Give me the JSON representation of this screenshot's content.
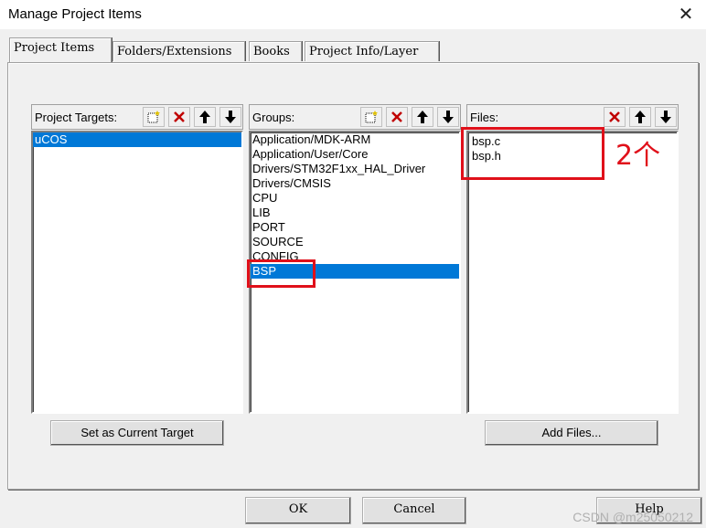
{
  "window": {
    "title": "Manage Project Items",
    "close_glyph": "✕"
  },
  "tabs": [
    {
      "label": "Project Items",
      "active": true
    },
    {
      "label": "Folders/Extensions",
      "active": false
    },
    {
      "label": "Books",
      "active": false
    },
    {
      "label": "Project Info/Layer",
      "active": false
    }
  ],
  "targets": {
    "label": "Project Targets:",
    "items": [
      "uCOS"
    ],
    "selected": "uCOS"
  },
  "groups": {
    "label": "Groups:",
    "items": [
      "Application/MDK-ARM",
      "Application/User/Core",
      "Drivers/STM32F1xx_HAL_Driver",
      "Drivers/CMSIS",
      "CPU",
      "LIB",
      "PORT",
      "SOURCE",
      "CONFIG",
      "BSP"
    ],
    "selected": "BSP"
  },
  "files": {
    "label": "Files:",
    "items": [
      "bsp.c",
      "bsp.h"
    ]
  },
  "buttons": {
    "set_current_target": "Set as Current Target",
    "add_files": "Add Files...",
    "ok": "OK",
    "cancel": "Cancel",
    "help": "Help"
  },
  "annotation": {
    "text": "2个"
  },
  "watermark": "CSDN @m25050212",
  "colors": {
    "selection": "#0078d7",
    "annotation_red": "#e0101a",
    "delete_red": "#c00000"
  },
  "icons": [
    "new-item-icon",
    "delete-icon",
    "move-up-icon",
    "move-down-icon"
  ]
}
